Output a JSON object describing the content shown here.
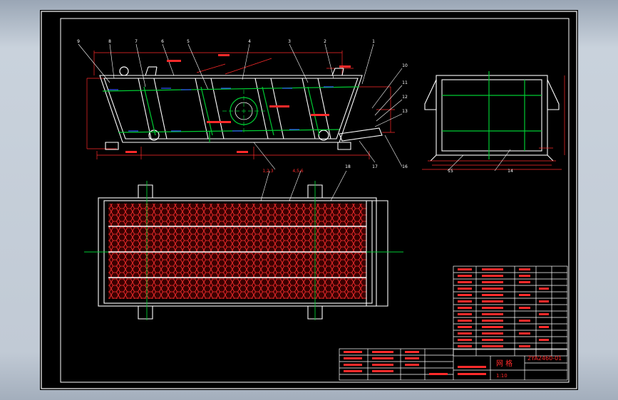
{
  "drawing": {
    "part_callouts": [
      "9",
      "8",
      "7",
      "6",
      "5",
      "4",
      "3",
      "2",
      "1",
      "10",
      "11",
      "12",
      "13",
      "14",
      "15",
      "16",
      "17",
      "18"
    ],
    "section_callouts": [
      "1,2,3",
      "4,5,6"
    ],
    "title_block": {
      "part_name": "网 格",
      "drawing_no": "2YA2460-01",
      "scale_label": "1:10"
    }
  },
  "colors": {
    "sheet_background": "#000000",
    "frame": "#ffffff",
    "outline": "#ffffff",
    "dimension": "#ff2a2a",
    "centerline": "#00cc33",
    "hidden": "#2f5cff",
    "screen_mesh": "#ff3030",
    "screen_fill": "#3a0000"
  }
}
